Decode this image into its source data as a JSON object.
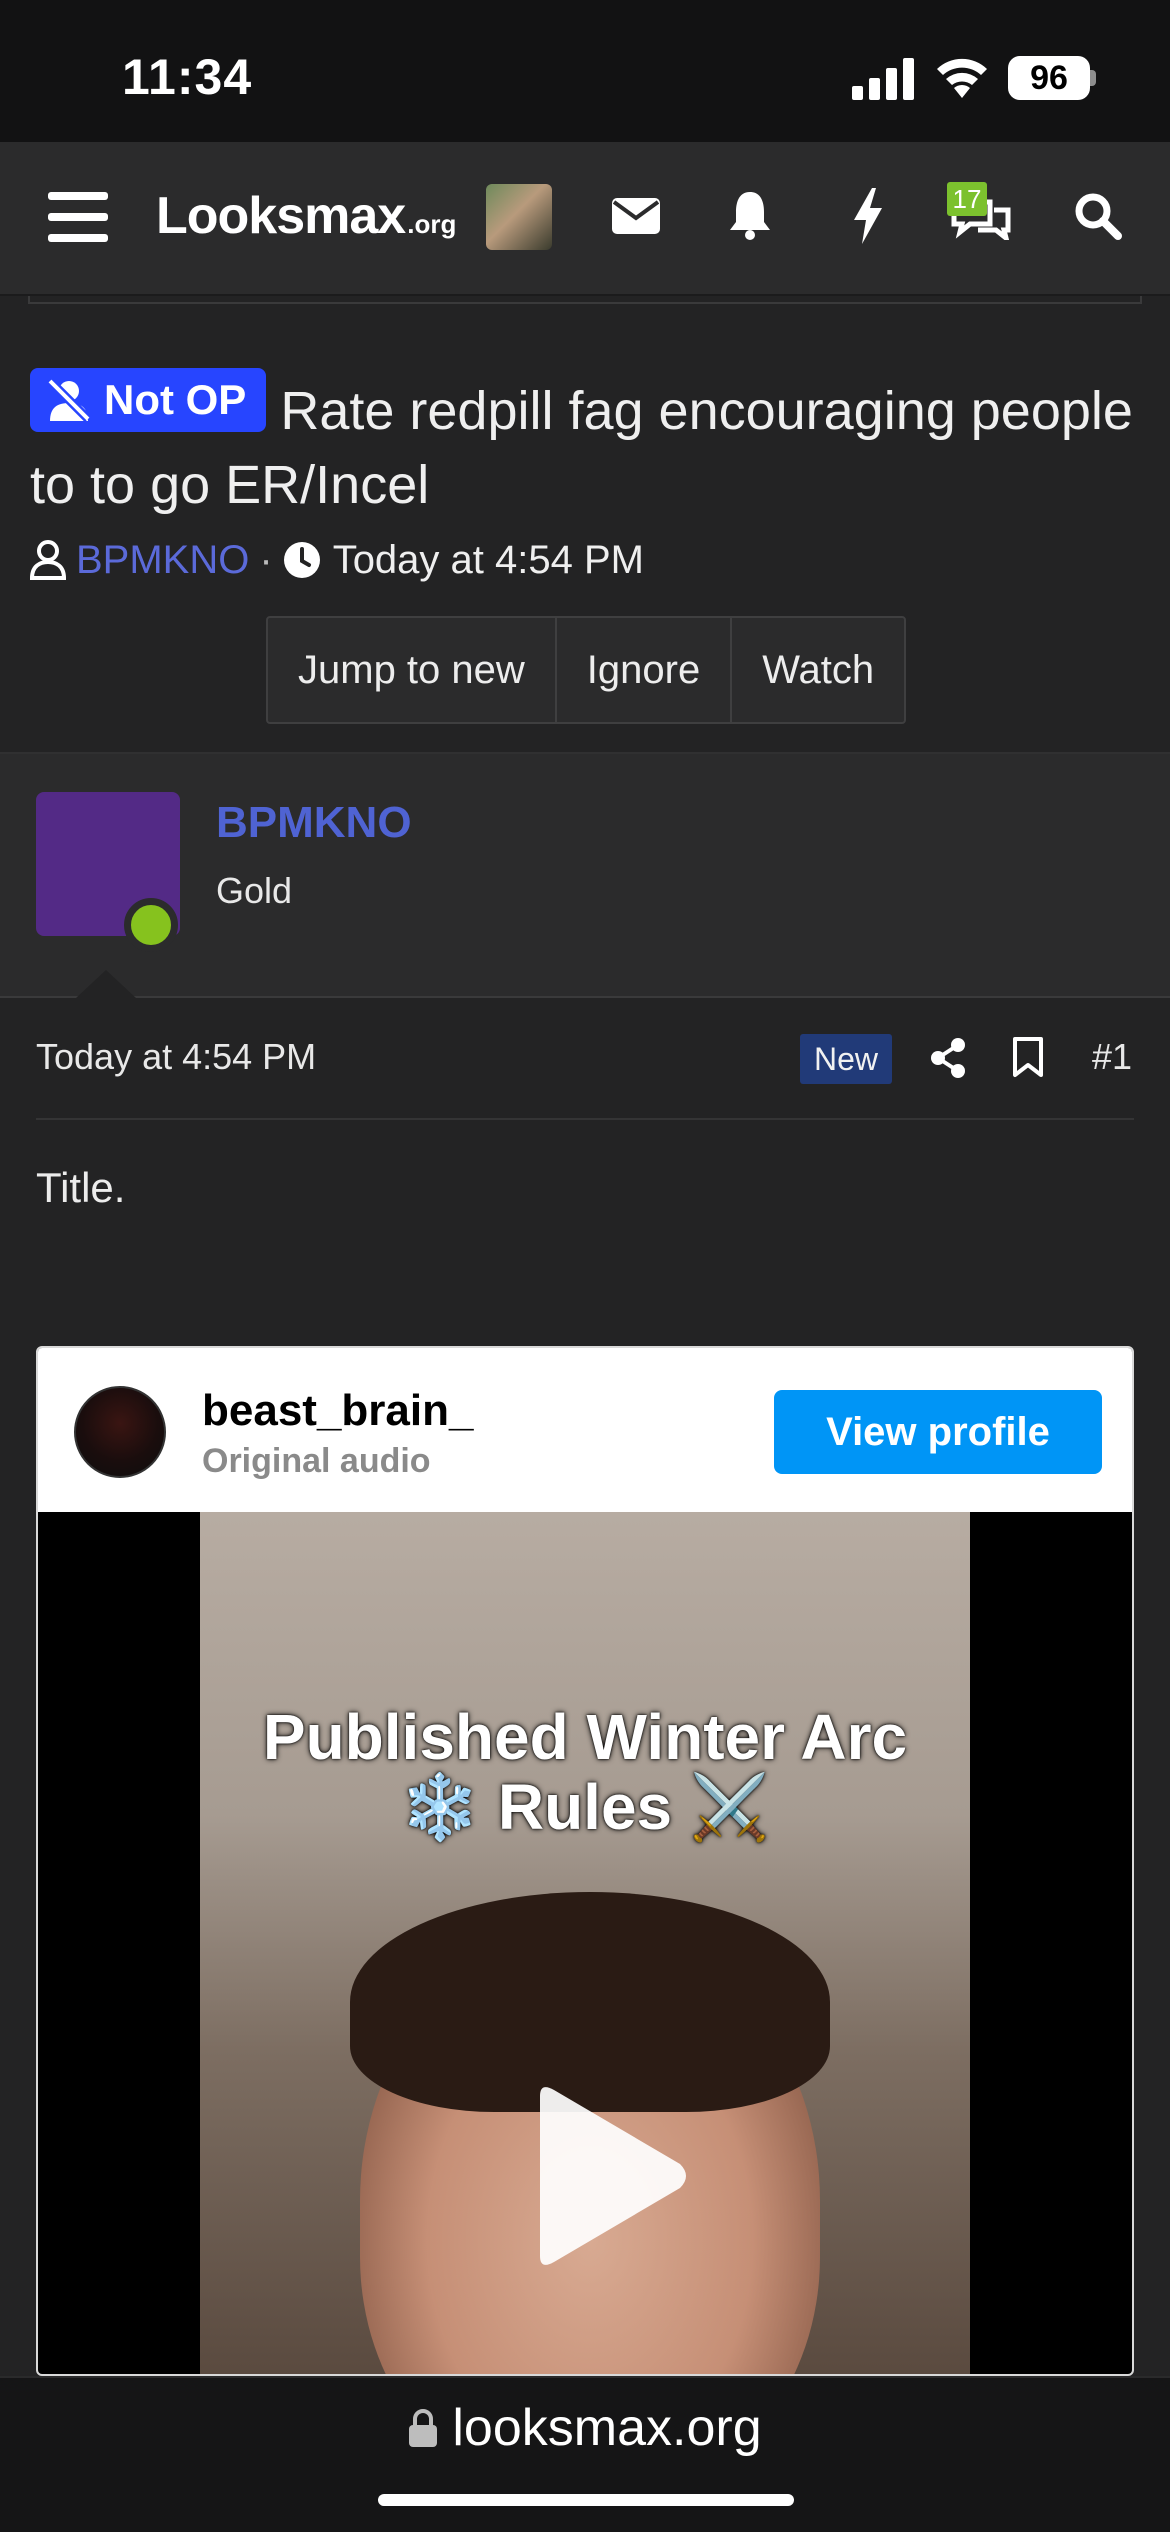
{
  "status_bar": {
    "time": "11:34",
    "battery": "96"
  },
  "nav": {
    "logo_main": "Looksmax",
    "logo_tld": ".org",
    "conversations_badge": "17",
    "icons": [
      "menu-icon",
      "mail-icon",
      "bell-icon",
      "lightning-icon",
      "conversations-icon",
      "search-icon"
    ]
  },
  "thread": {
    "badge_label": "Not OP",
    "title": "Rate redpill fag encouraging people to to go ER/Incel",
    "author": "BPMKNO",
    "separator": "·",
    "time": "Today at 4:54 PM",
    "buttons": [
      "Jump to new",
      "Ignore",
      "Watch"
    ]
  },
  "post": {
    "username": "BPMKNO",
    "rank": "Gold",
    "date": "Today at 4:54 PM",
    "new_label": "New",
    "number": "#1",
    "body": "Title."
  },
  "embed": {
    "account": "beast_brain_",
    "subtitle": "Original audio",
    "view_profile": "View profile",
    "caption_line1": "Published Winter Arc",
    "caption_line2": "❄️ Rules ⚔️"
  },
  "url_bar": {
    "domain": "looksmax.org"
  },
  "colors": {
    "accent_blue": "#2745ff",
    "username": "#4f63d3",
    "online": "#86c21e",
    "instagram_blue": "#0095f6"
  }
}
